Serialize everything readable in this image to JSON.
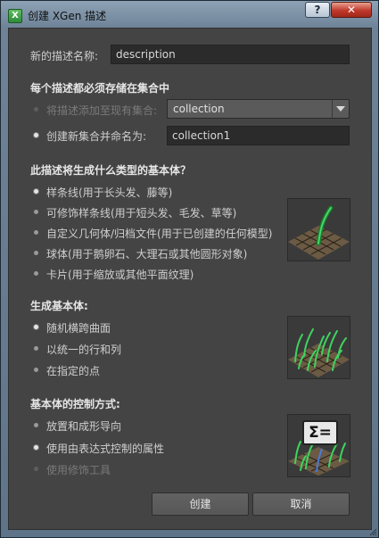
{
  "window": {
    "title": "创建 XGen 描述",
    "app_icon_text": "X",
    "help_label": "?",
    "close_label": "✕"
  },
  "description_name": {
    "label": "新的描述名称:",
    "value": "description"
  },
  "collection_section": {
    "heading": "每个描述都必须存储在集合中",
    "add_existing_label": "将描述添加至现有集合:",
    "existing_value": "collection",
    "create_new_label": "创建新集合并命名为:",
    "new_value": "collection1"
  },
  "primitive_type_section": {
    "heading": "此描述将生成什么类型的基本体？",
    "options": [
      {
        "label": "样条线(用于长头发、藤等)",
        "selected": true
      },
      {
        "label": "可修饰样条线(用于短头发、毛发、草等)",
        "selected": false
      },
      {
        "label": "自定义几何体/归档文件(用于已创建的任何模型)",
        "selected": false
      },
      {
        "label": "球体(用于鹅卵石、大理石或其他圆形对象)",
        "selected": false
      },
      {
        "label": "卡片(用于缩放或其他平面纹理)",
        "selected": false
      }
    ]
  },
  "generate_section": {
    "heading": "生成基本体:",
    "options": [
      {
        "label": "随机横跨曲面",
        "selected": true
      },
      {
        "label": "以统一的行和列",
        "selected": false
      },
      {
        "label": "在指定的点",
        "selected": false
      }
    ]
  },
  "control_section": {
    "heading": "基本体的控制方式:",
    "options": [
      {
        "label": "放置和成形导向",
        "selected": false,
        "enabled": true
      },
      {
        "label": "使用由表达式控制的属性",
        "selected": true,
        "enabled": true
      },
      {
        "label": "使用修饰工具",
        "selected": false,
        "enabled": false
      }
    ],
    "expression_glyph": "Σ="
  },
  "buttons": {
    "create": "创建",
    "cancel": "取消"
  },
  "colors": {
    "panel_bg": "#444444",
    "field_bg": "#2b2b2b",
    "grass_green": "#2fbf4f",
    "close_red": "#c0392b"
  },
  "icons": {
    "thumb_splines": "single-spline-strand-on-grid",
    "thumb_random": "random-grass-on-grid",
    "thumb_expression": "sigma-expression-grass"
  }
}
